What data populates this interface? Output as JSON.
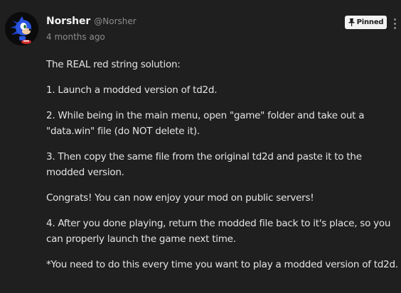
{
  "comment": {
    "author": "Norsher",
    "handle": "@Norsher",
    "timestamp": "4 months ago",
    "pinned_label": "Pinned",
    "paragraphs": [
      "The REAL red string solution:",
      "1. Launch a modded version of td2d.",
      "2. While being in the main menu, open \"game\" folder and take out a \"data.win\" file (do NOT delete it).",
      "3. Then copy the same file from the original td2d and paste it to the modded version.",
      "Congrats! You can now enjoy your mod on public servers!",
      "4. After you done playing, return the modded file back to it's place, so you can properly launch the game next time.",
      "*You need to do this every time you want to play a modded version of td2d."
    ]
  },
  "icons": {
    "avatar": "sonic-avatar",
    "pin": "pin-icon",
    "more": "more-vertical-icon"
  },
  "colors": {
    "background": "#1f1f1f",
    "text": "#e4e4e4",
    "muted": "#8c8c8c",
    "badge": "#f2f2f2"
  }
}
